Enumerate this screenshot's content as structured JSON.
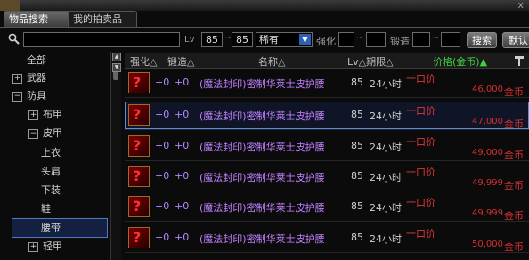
{
  "window": {
    "close_glyph": "x"
  },
  "tabs": [
    {
      "label": "物品搜索",
      "active": true
    },
    {
      "label": "我的拍卖品",
      "active": false
    }
  ],
  "search": {
    "query": "",
    "lv_label": "Lv",
    "lv_min": "85",
    "lv_sep": "~",
    "lv_max": "85",
    "rarity": "稀有",
    "enhance_label": "强化",
    "enhance_sep": "~",
    "forge_label": "锻造",
    "forge_sep": "~",
    "search_button": "搜索",
    "default_button": "默认"
  },
  "sidebar": {
    "items": [
      {
        "label": "全部",
        "box": ""
      },
      {
        "label": "武器",
        "box": "+"
      },
      {
        "label": "防具",
        "box": "−"
      },
      {
        "label": "布甲",
        "box": "+"
      },
      {
        "label": "皮甲",
        "box": "−"
      },
      {
        "label": "上衣",
        "box": ""
      },
      {
        "label": "头肩",
        "box": ""
      },
      {
        "label": "下装",
        "box": ""
      },
      {
        "label": "鞋",
        "box": ""
      },
      {
        "label": "腰带",
        "box": "",
        "selected": true
      },
      {
        "label": "轻甲",
        "box": "+"
      }
    ]
  },
  "table": {
    "headers": {
      "enhance": "强化△",
      "forge": "锻造△",
      "name": "名称△",
      "lv": "Lv△期限△",
      "price": "价格(金币)▲",
      "coin_icon": "hammer-icon"
    },
    "rows": [
      {
        "enhance": "+0",
        "forge": "+0",
        "name": "(魔法封印)密制华莱士皮护腰",
        "lv": "85",
        "time": "24小时",
        "price_label": "一口价",
        "price": "46,000",
        "currency": "金币"
      },
      {
        "enhance": "+0",
        "forge": "+0",
        "name": "(魔法封印)密制华莱士皮护腰",
        "lv": "85",
        "time": "24小时",
        "price_label": "一口价",
        "price": "47,000",
        "currency": "金币"
      },
      {
        "enhance": "+0",
        "forge": "+0",
        "name": "(魔法封印)密制华莱士皮护腰",
        "lv": "85",
        "time": "24小时",
        "price_label": "一口价",
        "price": "49,000",
        "currency": "金币"
      },
      {
        "enhance": "+0",
        "forge": "+0",
        "name": "(魔法封印)密制华莱士皮护腰",
        "lv": "85",
        "time": "24小时",
        "price_label": "一口价",
        "price": "49,999",
        "currency": "金币"
      },
      {
        "enhance": "+0",
        "forge": "+0",
        "name": "(魔法封印)密制华莱士皮护腰",
        "lv": "85",
        "time": "24小时",
        "price_label": "一口价",
        "price": "49,999",
        "currency": "金币"
      },
      {
        "enhance": "+0",
        "forge": "+0",
        "name": "(魔法封印)密制华莱士皮护腰",
        "lv": "85",
        "time": "24小时",
        "price_label": "一口价",
        "price": "50,000",
        "currency": "金币"
      }
    ]
  },
  "colors": {
    "price_header": "#3ed03e",
    "price": "#d23030",
    "item_name": "#c080ff",
    "selection": "#5a8be0"
  }
}
